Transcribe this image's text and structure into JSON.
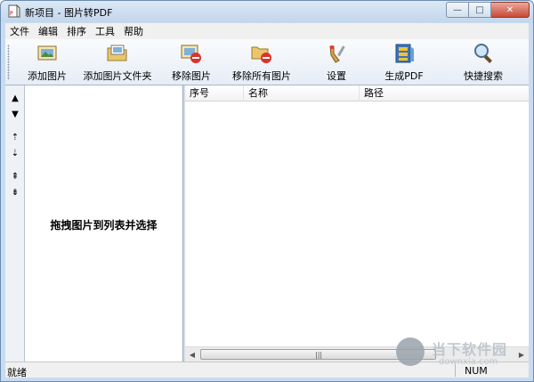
{
  "window": {
    "title": "新项目 - 图片转PDF",
    "controls": {
      "minimize": "—",
      "maximize": "□",
      "close": "✕"
    }
  },
  "menu": [
    "文件",
    "编辑",
    "排序",
    "工具",
    "帮助"
  ],
  "toolbar": {
    "add_image": "添加图片",
    "add_folder": "添加图片文件夹",
    "remove_image": "移除图片",
    "remove_all": "移除所有图片",
    "settings": "设置",
    "generate_pdf": "生成PDF",
    "quick_search": "快捷搜索"
  },
  "side_buttons": [
    "▲",
    "▼",
    "⇡",
    "⇣",
    "⇞",
    "⇟"
  ],
  "left_pane": {
    "hint": "拖拽图片到列表并选择"
  },
  "list": {
    "columns": [
      "序号",
      "名称",
      "路径"
    ]
  },
  "scrollbar": {
    "left_arrow": "◀",
    "right_arrow": "▶",
    "grip": "|||"
  },
  "status": {
    "text": "就绪",
    "num": "NUM"
  },
  "watermark": {
    "title": "当下软件园",
    "sub": "downxia.com"
  }
}
